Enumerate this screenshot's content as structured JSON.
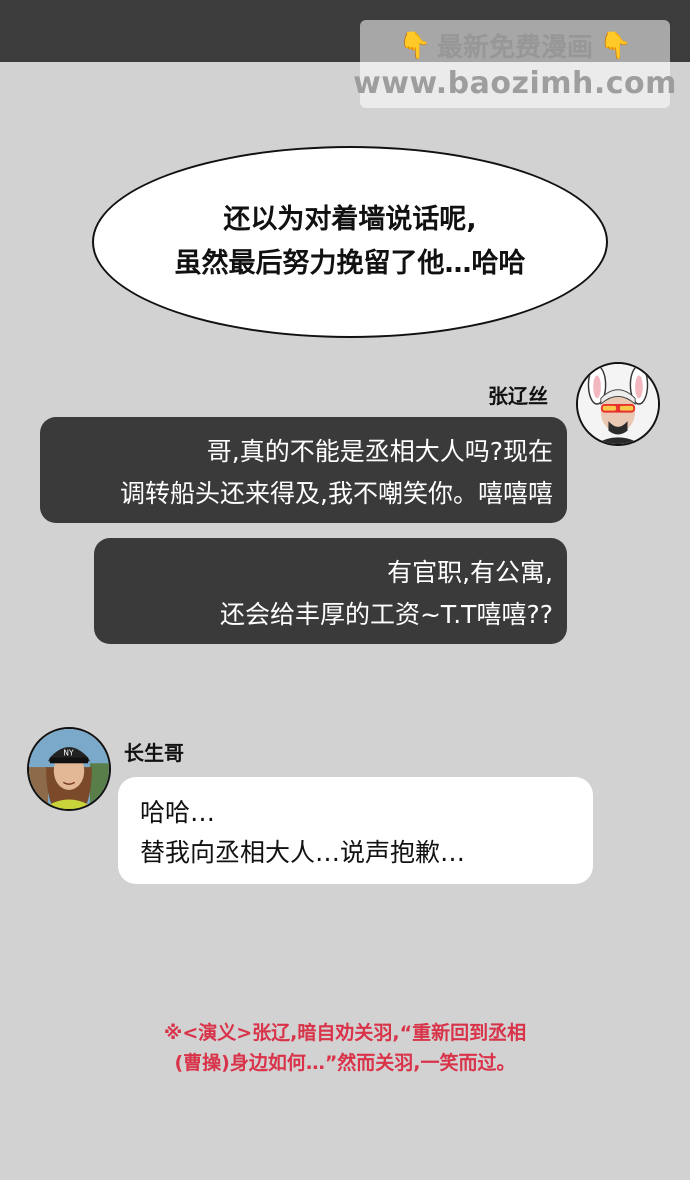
{
  "watermark": {
    "line1": "最新免费漫画",
    "line2": "www.baozimh.com",
    "hand_icon": "👇"
  },
  "thought_bubble": {
    "lines": [
      "还以为对着墙说话呢,",
      "虽然最后努力挽留了他…哈哈"
    ]
  },
  "chat": {
    "sender1": {
      "name": "张辽丝",
      "messages": [
        [
          "哥,真的不能是丞相大人吗?现在",
          "调转船头还来得及,我不嘲笑你。嘻嘻嘻"
        ],
        [
          "有官职,有公寓,",
          "还会给丰厚的工资~T.T嘻嘻??"
        ]
      ]
    },
    "sender2": {
      "name": "长生哥",
      "messages": [
        [
          "哈哈…",
          "替我向丞相大人…说声抱歉…"
        ]
      ]
    }
  },
  "footnote": {
    "lines": [
      "※<演义>张辽,暗自劝关羽,“重新回到丞相",
      "(曹操)身边如何…”然而关羽,一笑而过。"
    ]
  },
  "colors": {
    "background": "#d2d2d2",
    "top_bar": "#3c3c3c",
    "dark_bubble": "#3a3a3a",
    "footnote": "#d9334a"
  }
}
